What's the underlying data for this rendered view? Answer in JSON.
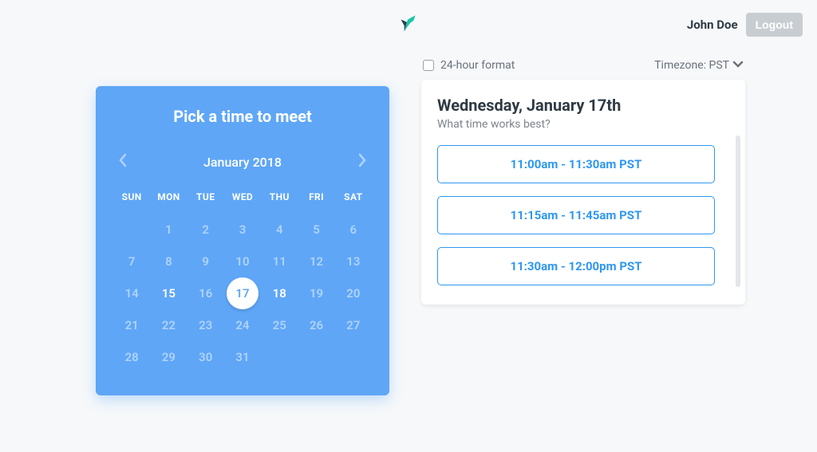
{
  "brand": {
    "icon_name": "hummingbird-icon"
  },
  "header": {
    "user_name": "John Doe",
    "logout_label": "Logout"
  },
  "calendar": {
    "title": "Pick a time to meet",
    "month_label": "January 2018",
    "dow": [
      "SUN",
      "MON",
      "TUE",
      "WED",
      "THU",
      "FRI",
      "SAT"
    ],
    "weeks": [
      [
        {
          "n": ""
        },
        {
          "n": "1"
        },
        {
          "n": "2"
        },
        {
          "n": "3"
        },
        {
          "n": "4"
        },
        {
          "n": "5"
        },
        {
          "n": "6"
        }
      ],
      [
        {
          "n": "7"
        },
        {
          "n": "8"
        },
        {
          "n": "9"
        },
        {
          "n": "10"
        },
        {
          "n": "11"
        },
        {
          "n": "12"
        },
        {
          "n": "13"
        }
      ],
      [
        {
          "n": "14"
        },
        {
          "n": "15",
          "avail": true
        },
        {
          "n": "16"
        },
        {
          "n": "17",
          "avail": true,
          "selected": true
        },
        {
          "n": "18",
          "avail": true
        },
        {
          "n": "19"
        },
        {
          "n": "20"
        }
      ],
      [
        {
          "n": "21"
        },
        {
          "n": "22"
        },
        {
          "n": "23"
        },
        {
          "n": "24"
        },
        {
          "n": "25"
        },
        {
          "n": "26"
        },
        {
          "n": "27"
        }
      ],
      [
        {
          "n": "28"
        },
        {
          "n": "29"
        },
        {
          "n": "30"
        },
        {
          "n": "31"
        },
        {
          "n": ""
        },
        {
          "n": ""
        },
        {
          "n": ""
        }
      ]
    ]
  },
  "options": {
    "format_label": "24-hour format",
    "format_checked": false,
    "timezone_label": "Timezone: PST"
  },
  "slots": {
    "title": "Wednesday, January 17th",
    "subtitle": "What time works best?",
    "items": [
      "11:00am - 11:30am PST",
      "11:15am - 11:45am PST",
      "11:30am - 12:00pm PST"
    ]
  }
}
